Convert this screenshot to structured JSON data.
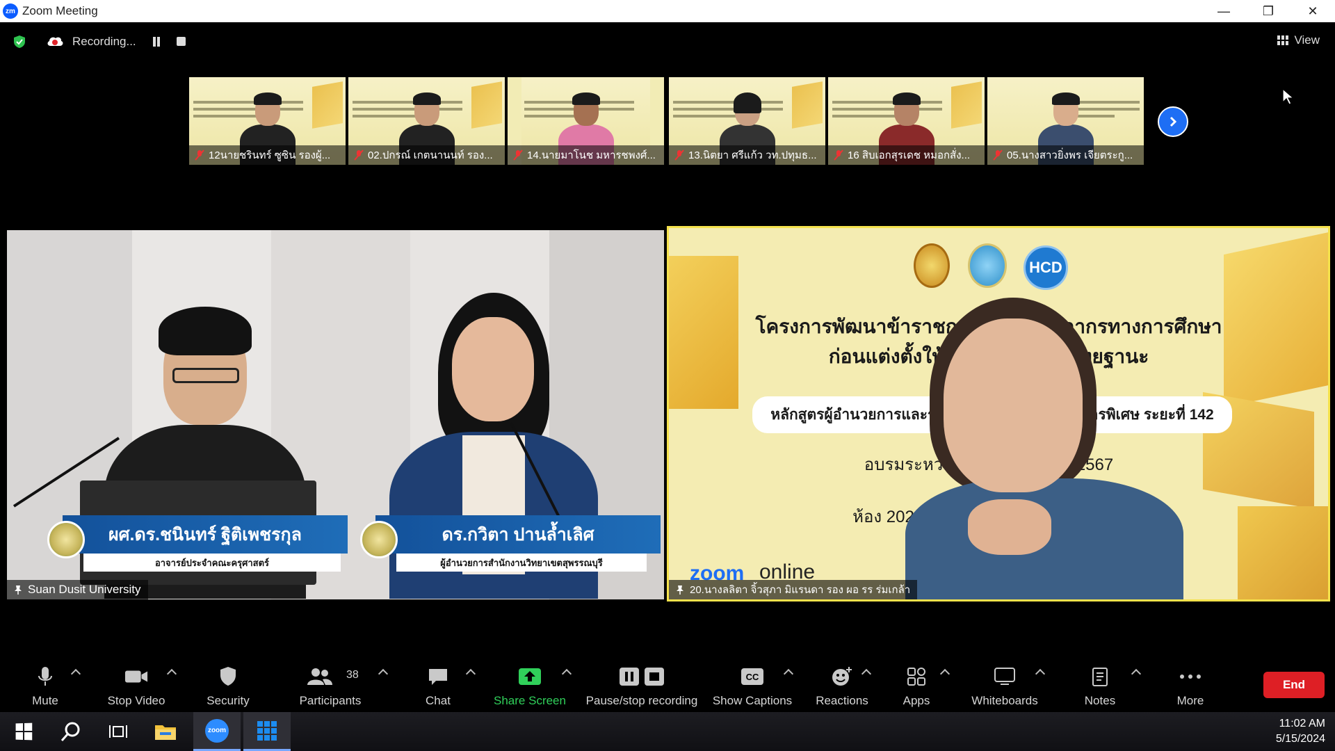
{
  "window": {
    "title": "Zoom Meeting",
    "app_logo_text": "zm"
  },
  "status": {
    "recording_text": "Recording...",
    "view_label": "View"
  },
  "thumbnails": [
    {
      "name": "12นายชรินทร์ ซูซิน รองผู้..."
    },
    {
      "name": "02.ปกรณ์ เกตนานนท์ รอง..."
    },
    {
      "name": "14.นายมาโนช มหารชพงศ์..."
    },
    {
      "name": "13.นิตยา ศรีแก้ว วท.ปทุมธ..."
    },
    {
      "name": "16 สิบเอกสุรเดช หมอกสั่ง..."
    },
    {
      "name": "05.นางสาวยิ่งพร เจียตระกู..."
    }
  ],
  "main_left": {
    "label": "Suan Dusit University",
    "lower_third_1": {
      "name": "ผศ.ดร.ชนินทร์ ฐิติเพชรกุล",
      "title": "อาจารย์ประจำคณะครุศาสตร์"
    },
    "lower_third_2": {
      "name": "ดร.กวิตา ปานล้ำเลิศ",
      "title": "ผู้อำนวยการสำนักงานวิทยาเขตสุพรรณบุรี"
    }
  },
  "main_right": {
    "label": "20.นางลลิตา จิ้วสุภา มิแรนดา รอง ผอ รร ร่มเกล้า",
    "hcd_logo": "HCD",
    "slide_line1": "โครงการพัฒนาข้าราชการครูและบุคลากรทางการศึกษา",
    "slide_line2": "ก่อนแต่งตั้งให้มีและเลื่อนเป็นวิทยฐานะ",
    "slide_line3": "หลักสูตรผู้อำนวยการและรองผู้อำนวยการ ชำนาญการพิเศษ ระยะที่ 142",
    "slide_line4": "อบรมระหว่างวันที่ พฤษภาคม 2567",
    "slide_line5": "ห้อง 202 ศูนย์พัฒนา สุพรรณบุรี พันธิน",
    "zoom_word": "zoom",
    "online_word": "online"
  },
  "toolbar": {
    "mute": "Mute",
    "stop_video": "Stop Video",
    "security": "Security",
    "participants": "Participants",
    "participants_count": "38",
    "chat": "Chat",
    "share_screen": "Share Screen",
    "pause_recording": "Pause/stop recording",
    "show_captions": "Show Captions",
    "captions_icon_text": "CC",
    "reactions": "Reactions",
    "apps": "Apps",
    "whiteboards": "Whiteboards",
    "notes": "Notes",
    "more": "More",
    "end": "End"
  },
  "taskbar": {
    "time": "11:02 AM",
    "date": "5/15/2024",
    "zoom_icon_text": "zoom"
  },
  "colors": {
    "accent": "#0b5cff",
    "share_green": "#30d05a",
    "end_red": "#de1f25",
    "active_speaker_border": "#f5e24c"
  }
}
